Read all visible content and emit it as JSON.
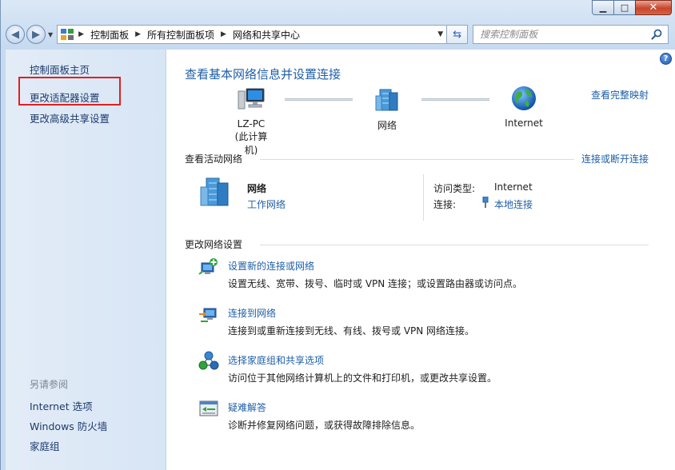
{
  "window": {
    "caption": {
      "minimize": "▁",
      "maximize": "□",
      "close": "✕"
    }
  },
  "address_bar": {
    "crumbs": [
      "控制面板",
      "所有控制面板项",
      "网络和共享中心"
    ],
    "search_placeholder": "搜索控制面板"
  },
  "left_pane": {
    "links": [
      "控制面板主页",
      "更改适配器设置",
      "更改高级共享设置"
    ],
    "see_also_label": "另请参阅",
    "see_also": [
      "Internet 选项",
      "Windows 防火墙",
      "家庭组"
    ]
  },
  "main": {
    "title": "查看基本网络信息并设置连接",
    "view_full_map": "查看完整映射",
    "map": {
      "computer_name": "LZ-PC",
      "computer_sub": "(此计算机)",
      "network": "网络",
      "internet": "Internet"
    },
    "active_networks": {
      "label": "查看活动网络",
      "connect_link": "连接或断开连接",
      "network_name": "网络",
      "network_type": "工作网络",
      "access_type_label": "访问类型:",
      "access_type_value": "Internet",
      "connection_label": "连接:",
      "connection_value": "本地连接"
    },
    "change_settings": {
      "label": "更改网络设置",
      "tasks": [
        {
          "title": "设置新的连接或网络",
          "desc": "设置无线、宽带、拨号、临时或 VPN 连接；或设置路由器或访问点。",
          "icon": "new-connection-icon"
        },
        {
          "title": "连接到网络",
          "desc": "连接到或重新连接到无线、有线、拨号或 VPN 网络连接。",
          "icon": "connect-network-icon"
        },
        {
          "title": "选择家庭组和共享选项",
          "desc": "访问位于其他网络计算机上的文件和打印机，或更改共享设置。",
          "icon": "homegroup-icon"
        },
        {
          "title": "疑难解答",
          "desc": "诊断并修复网络问题，或获得故障排除信息。",
          "icon": "troubleshoot-icon"
        }
      ]
    }
  },
  "colors": {
    "link": "#1e5ea8",
    "highlight": "#e02020"
  }
}
